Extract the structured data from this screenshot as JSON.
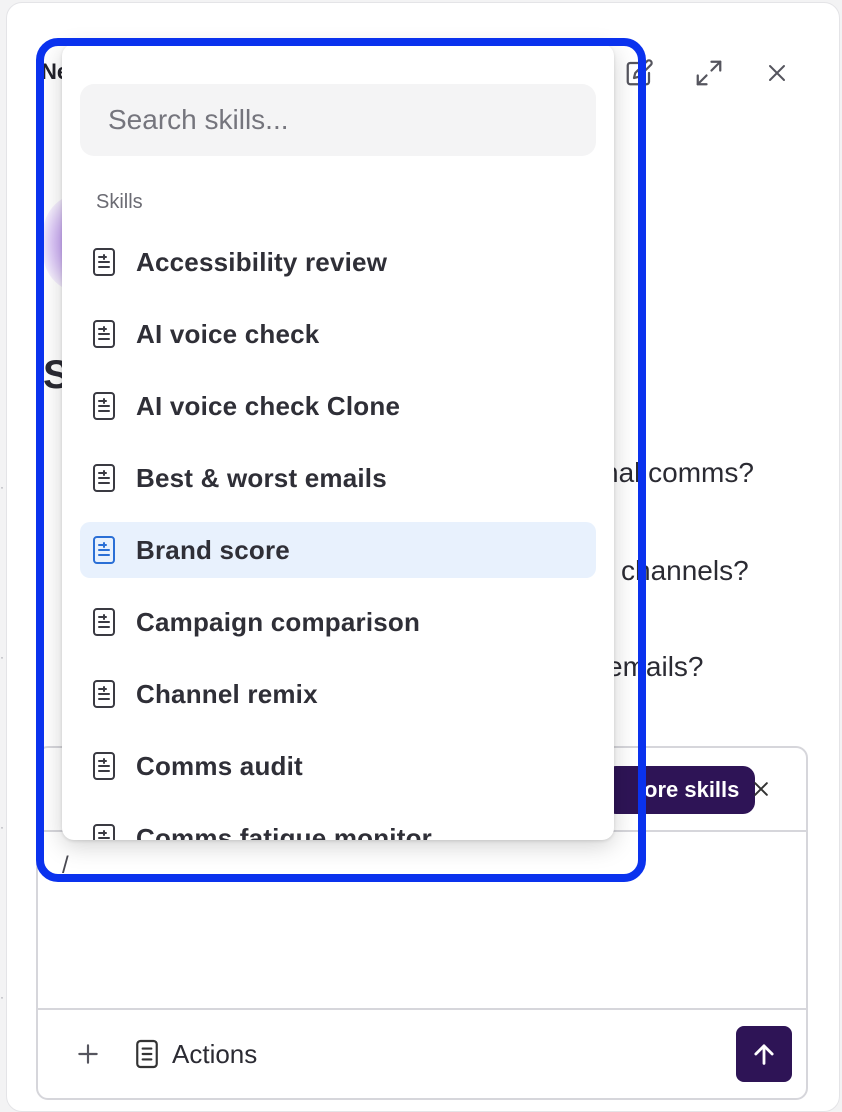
{
  "header": {
    "title": "Ne",
    "edit_icon": "edit-icon",
    "expand_icon": "expand-icon",
    "close_icon": "close-icon"
  },
  "background": {
    "heading": "S",
    "suggestions": [
      "nal comms?",
      "channels?",
      "emails?"
    ]
  },
  "composer": {
    "chip_label": "ore skills",
    "chip_close_icon": "close-icon",
    "input_value": "/",
    "plus_icon": "plus-icon",
    "actions_label": "Actions",
    "actions_icon": "document-icon",
    "send_icon": "arrow-up-icon"
  },
  "dropdown": {
    "search_placeholder": "Search skills...",
    "section_label": "Skills",
    "items": [
      {
        "label": "Accessibility review",
        "selected": false
      },
      {
        "label": "AI voice check",
        "selected": false
      },
      {
        "label": "AI voice check Clone",
        "selected": false
      },
      {
        "label": "Best & worst emails",
        "selected": false
      },
      {
        "label": "Brand score",
        "selected": true
      },
      {
        "label": "Campaign comparison",
        "selected": false
      },
      {
        "label": "Channel remix",
        "selected": false
      },
      {
        "label": "Comms audit",
        "selected": false
      },
      {
        "label": "Comms fatigue monitor",
        "selected": false
      }
    ]
  },
  "colors": {
    "accent": "#2e1456",
    "highlight_border": "#0a32ee",
    "selected_bg": "#e8f1fd",
    "selected_icon": "#2a6fd6"
  }
}
